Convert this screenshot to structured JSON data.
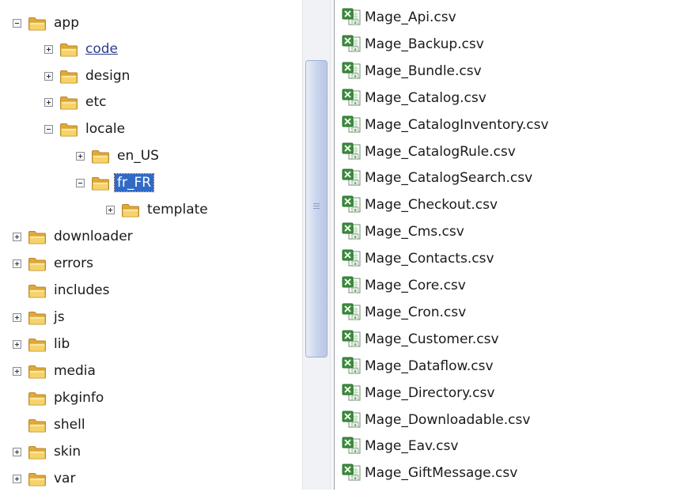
{
  "tree": {
    "items": [
      {
        "label": "app",
        "depth": 0,
        "expander": "minus"
      },
      {
        "label": "code",
        "depth": 1,
        "expander": "plus",
        "state": "link"
      },
      {
        "label": "design",
        "depth": 1,
        "expander": "plus"
      },
      {
        "label": "etc",
        "depth": 1,
        "expander": "plus"
      },
      {
        "label": "locale",
        "depth": 1,
        "expander": "minus"
      },
      {
        "label": "en_US",
        "depth": 2,
        "expander": "plus"
      },
      {
        "label": "fr_FR",
        "depth": 2,
        "expander": "minus",
        "state": "selected"
      },
      {
        "label": "template",
        "depth": 3,
        "expander": "plus"
      },
      {
        "label": "downloader",
        "depth": 0,
        "expander": "plus"
      },
      {
        "label": "errors",
        "depth": 0,
        "expander": "plus"
      },
      {
        "label": "includes",
        "depth": 0,
        "expander": "none"
      },
      {
        "label": "js",
        "depth": 0,
        "expander": "plus"
      },
      {
        "label": "lib",
        "depth": 0,
        "expander": "plus"
      },
      {
        "label": "media",
        "depth": 0,
        "expander": "plus"
      },
      {
        "label": "pkginfo",
        "depth": 0,
        "expander": "none"
      },
      {
        "label": "shell",
        "depth": 0,
        "expander": "none"
      },
      {
        "label": "skin",
        "depth": 0,
        "expander": "plus"
      },
      {
        "label": "var",
        "depth": 0,
        "expander": "plus"
      }
    ]
  },
  "files": {
    "icon": "excel-csv-icon",
    "items": [
      "Mage_Api.csv",
      "Mage_Backup.csv",
      "Mage_Bundle.csv",
      "Mage_Catalog.csv",
      "Mage_CatalogInventory.csv",
      "Mage_CatalogRule.csv",
      "Mage_CatalogSearch.csv",
      "Mage_Checkout.csv",
      "Mage_Cms.csv",
      "Mage_Contacts.csv",
      "Mage_Core.csv",
      "Mage_Cron.csv",
      "Mage_Customer.csv",
      "Mage_Dataflow.csv",
      "Mage_Directory.csv",
      "Mage_Downloadable.csv",
      "Mage_Eav.csv",
      "Mage_GiftMessage.csv"
    ]
  },
  "colors": {
    "selection": "#316ac5",
    "link": "#2c3f8f",
    "folder": "#f3cd56",
    "excel": "#3c8f3c"
  }
}
